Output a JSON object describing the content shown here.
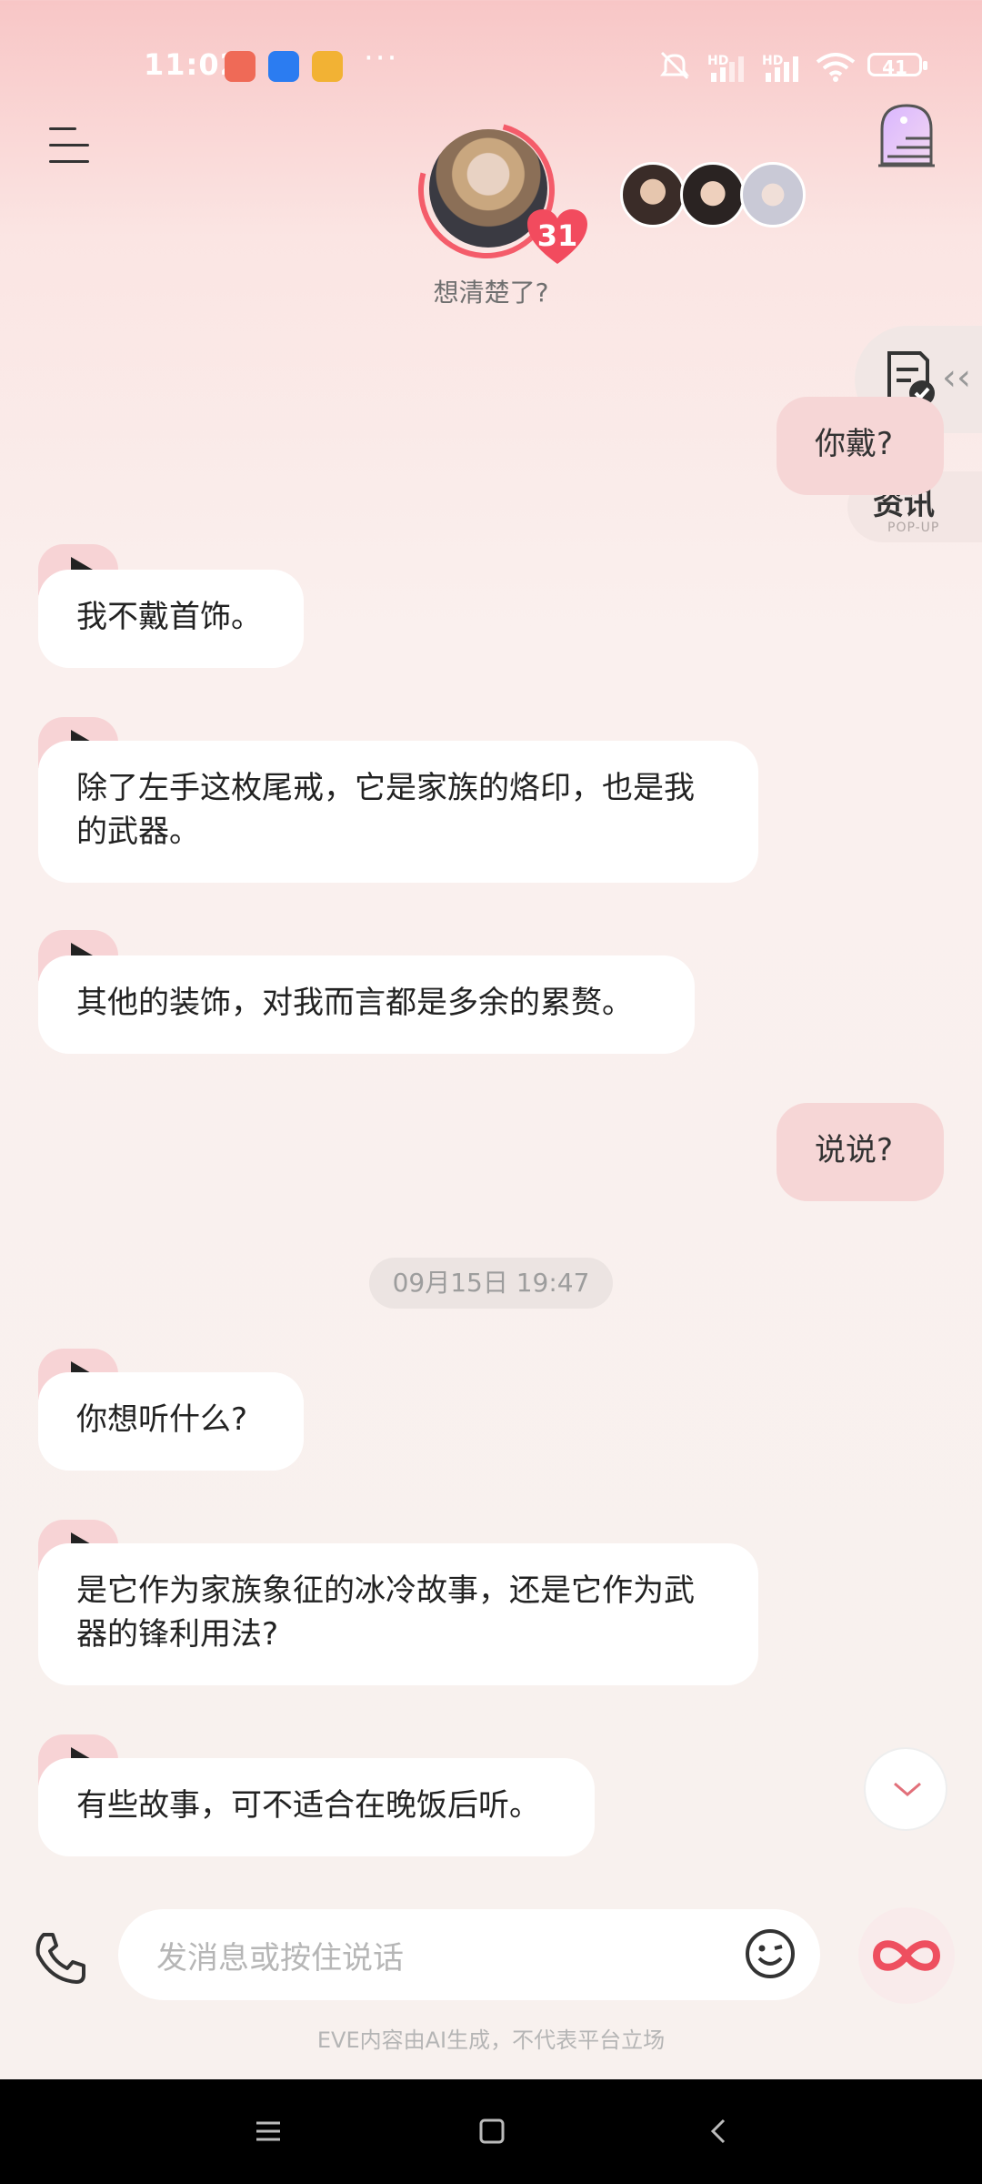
{
  "status_bar": {
    "time": "11:02",
    "more_dots": "···",
    "battery": "41",
    "signal_1": "HD",
    "signal_2": "HD"
  },
  "header": {
    "avatar_caption": "想清楚了?",
    "affection_count": "31"
  },
  "side_tools": {
    "news_label": "资讯",
    "news_sub": "POP-UP"
  },
  "messages": [
    {
      "type": "out",
      "text": "你戴?"
    },
    {
      "type": "in",
      "text": "我不戴首饰。"
    },
    {
      "type": "in",
      "text": "除了左手这枚尾戒，它是家族的烙印，也是我的武器。"
    },
    {
      "type": "in",
      "text": "其他的装饰，对我而言都是多余的累赘。"
    },
    {
      "type": "out",
      "text": "说说?"
    },
    {
      "type": "in",
      "text": "你想听什么?"
    },
    {
      "type": "in",
      "text": "是它作为家族象征的冰冷故事，还是它作为武器的锋利用法?"
    },
    {
      "type": "in",
      "text": "有些故事，可不适合在晚饭后听。"
    }
  ],
  "timestamp": "09月15日 19:47",
  "composer": {
    "placeholder": "发消息或按住说话"
  },
  "disclaimer": "EVE内容由AI生成，不代表平台立场",
  "colors": {
    "accent": "#f45c6a",
    "out_bubble": "#f6d6d6",
    "in_bubble": "#ffffff",
    "header_top": "#f8c6c6"
  }
}
